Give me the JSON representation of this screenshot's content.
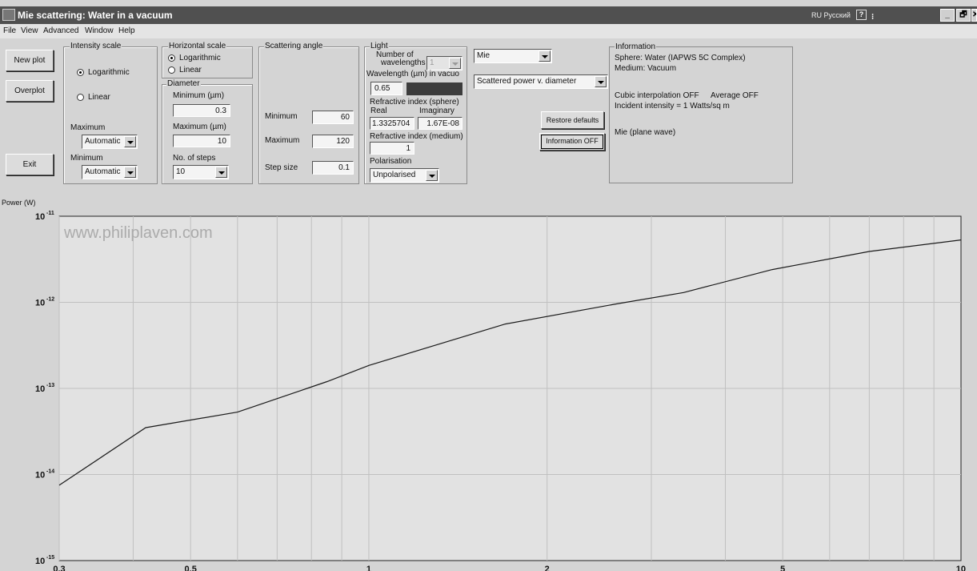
{
  "window": {
    "title": "Mie scattering:  Water in a vacuum",
    "language": "RU Русский",
    "help_icon": "question-icon",
    "controls": [
      "_",
      "🗗",
      "✕"
    ]
  },
  "menu": [
    "File",
    "View",
    "Advanced",
    "Window",
    "Help"
  ],
  "buttons": {
    "new_plot": "New plot",
    "overplot": "Overplot",
    "exit": "Exit",
    "restore_defaults": "Restore defaults",
    "information_off": "Information OFF"
  },
  "intensity_scale": {
    "group_label": "Intensity scale",
    "logarithmic": "Logarithmic",
    "linear": "Linear",
    "selected": "Logarithmic",
    "maximum_label": "Maximum",
    "maximum_value": "Automatic",
    "minimum_label": "Minimum",
    "minimum_value": "Automatic"
  },
  "horizontal_scale": {
    "group_label": "Horizontal scale",
    "logarithmic": "Logarithmic",
    "linear": "Linear",
    "selected": "Logarithmic"
  },
  "diameter": {
    "group_label": "Diameter",
    "min_label": "Minimum (µm)",
    "min_value": "0.3",
    "max_label": "Maximum (µm)",
    "max_value": "10",
    "steps_label": "No. of steps",
    "steps_value": "10"
  },
  "scattering_angle": {
    "group_label": "Scattering angle",
    "min_label": "Minimum",
    "min_value": "60",
    "max_label": "Maximum",
    "max_value": "120",
    "step_label": "Step size",
    "step_value": "0.1"
  },
  "light": {
    "group_label": "Light",
    "num_wavelengths_label_1": "Number of",
    "num_wavelengths_label_2": "wavelengths",
    "num_wavelengths_value": "1",
    "wavelength_label": "Wavelength (µm) in vacuo",
    "wavelength_value": "0.65",
    "ri_sphere_label": "Refractive index (sphere)",
    "real_label": "Real",
    "imag_label": "Imaginary",
    "real_value": "1.3325704",
    "imag_value": "1.67E-08",
    "ri_medium_label": "Refractive index (medium)",
    "ri_medium_value": "1",
    "polarisation_label": "Polarisation",
    "polarisation_value": "Unpolarised"
  },
  "method": {
    "theory": "Mie",
    "plot_type": "Scattered power v. diameter"
  },
  "information": {
    "group_label": "Information",
    "sphere": "Sphere: Water (IAPWS 5C Complex)",
    "medium": "Medium: Vacuum",
    "cubic": "Cubic interpolation OFF",
    "average": "Average OFF",
    "incident": "Incident intensity = 1 Watts/sq m",
    "mie": "Mie (plane wave)"
  },
  "chart_data": {
    "type": "line",
    "ylabel": "Power (W)",
    "watermark": "www.philiplaven.com",
    "xscale": "log",
    "yscale": "log",
    "xlim": [
      0.3,
      10
    ],
    "ylim": [
      1e-15,
      1e-11
    ],
    "x_ticks": [
      "0.3",
      "0.5",
      "1",
      "2",
      "5",
      "10"
    ],
    "x_tick_values": [
      0.3,
      0.5,
      1,
      2,
      5,
      10
    ],
    "y_tick_exponents": [
      "-11",
      "-12",
      "-13",
      "-14",
      "-15"
    ],
    "y_tick_base": "10",
    "grid": true,
    "series": [
      {
        "x": [
          0.3,
          0.42,
          0.6,
          0.85,
          1.0,
          1.7,
          2.6,
          3.4,
          4.8,
          7.0,
          10
        ],
        "y": [
          7.5e-15,
          3.5e-14,
          5.3e-14,
          1.2e-13,
          1.85e-13,
          5.6e-13,
          9.5e-13,
          1.3e-12,
          2.4e-12,
          3.9e-12,
          5.3e-12
        ]
      }
    ],
    "colors": {
      "background": "#e2e2e2",
      "line": "#1a1a1a",
      "grid": "#c0c0c0"
    }
  }
}
